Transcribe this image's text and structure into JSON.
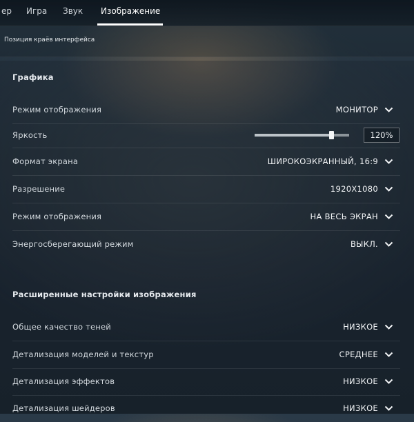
{
  "tabs": [
    {
      "label": "ер",
      "active": false
    },
    {
      "label": "Игра",
      "active": false
    },
    {
      "label": "Звук",
      "active": false
    },
    {
      "label": "Изображение",
      "active": true
    }
  ],
  "subnav": {
    "item": "Позиция краёв интерфейса"
  },
  "graphics": {
    "title": "Графика",
    "rows": [
      {
        "label": "Режим отображения",
        "value": "МОНИТОР",
        "type": "dropdown"
      },
      {
        "label": "Яркость",
        "value": "120%",
        "type": "slider",
        "level": 0.82
      },
      {
        "label": "Формат экрана",
        "value": "ШИРОКОЭКРАННЫЙ, 16:9",
        "type": "dropdown"
      },
      {
        "label": "Разрешение",
        "value": "1920X1080",
        "type": "dropdown"
      },
      {
        "label": "Режим отображения",
        "value": "НА ВЕСЬ ЭКРАН",
        "type": "dropdown"
      },
      {
        "label": "Энергосберегающий режим",
        "value": "ВЫКЛ.",
        "type": "dropdown"
      }
    ]
  },
  "advanced": {
    "title": "Расширенные настройки изображения",
    "rows": [
      {
        "label": "Общее качество теней",
        "value": "НИЗКОЕ",
        "type": "dropdown"
      },
      {
        "label": "Детализация моделей и текстур",
        "value": "СРЕДНЕЕ",
        "type": "dropdown"
      },
      {
        "label": "Детализация эффектов",
        "value": "НИЗКОЕ",
        "type": "dropdown"
      },
      {
        "label": "Детализация шейдеров",
        "value": "НИЗКОЕ",
        "type": "dropdown"
      }
    ]
  },
  "icons": {
    "dropdown": "chevron-down-icon"
  },
  "colors": {
    "accent": "#ffffff",
    "slider_fill": "#bcc3c8",
    "slider_track": "#8c949a"
  }
}
